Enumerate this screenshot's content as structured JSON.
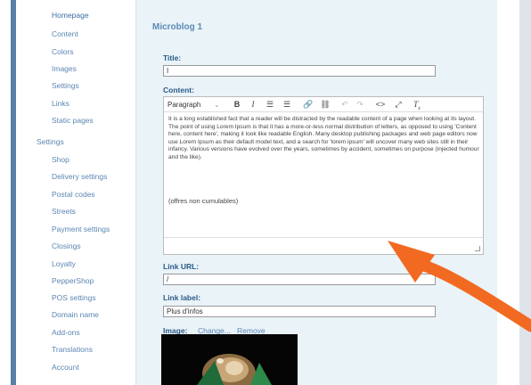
{
  "sidebar": {
    "items": [
      {
        "label": "Homepage",
        "active": true
      },
      {
        "label": "Content"
      },
      {
        "label": "Colors"
      },
      {
        "label": "Images"
      },
      {
        "label": "Settings"
      },
      {
        "label": "Links"
      },
      {
        "label": "Static pages"
      }
    ],
    "section_settings": "Settings",
    "settings_items": [
      {
        "label": "Shop"
      },
      {
        "label": "Delivery settings"
      },
      {
        "label": "Postal codes"
      },
      {
        "label": "Streets"
      },
      {
        "label": "Payment settings"
      },
      {
        "label": "Closings"
      },
      {
        "label": "Loyalty"
      },
      {
        "label": "PepperShop"
      },
      {
        "label": "POS settings"
      },
      {
        "label": "Domain name"
      },
      {
        "label": "Add-ons"
      },
      {
        "label": "Translations"
      },
      {
        "label": "Account"
      }
    ]
  },
  "main": {
    "title": "Microblog 1",
    "title_label": "Title:",
    "title_value": "I",
    "content_label": "Content:",
    "editor": {
      "format_select": "Paragraph",
      "body": "It is a long established fact that a reader will be distracted by the readable content of a page when looking at its layout. The point of using Lorem Ipsum is that it has a more-or-less normal distribution of letters, as opposed to using 'Content here, content here', making it look like readable English. Many desktop publishing packages and web page editors now use Lorem Ipsum as their default model text, and a search for 'lorem ipsum' will uncover many web sites still in their infancy. Various versions have evolved over the years, sometimes by accident, sometimes on purpose (injected humour and the like).",
      "note": "(offres non cumulables)"
    },
    "link_url_label": "Link URL:",
    "link_url_value": "/",
    "link_label_label": "Link label:",
    "link_label_value": "Plus d'infos",
    "image_label": "Image:",
    "image_change": "Change...",
    "image_remove": "Remove"
  },
  "colors": {
    "accent_arrow": "#f26a21",
    "link": "#5b86b3",
    "label": "#2b5b87"
  },
  "icons": [
    "bold-icon",
    "italic-icon",
    "numbered-list-icon",
    "bullet-list-icon",
    "link-icon",
    "unlink-icon",
    "undo-icon",
    "redo-icon",
    "source-code-icon",
    "fullscreen-icon",
    "clear-format-icon"
  ]
}
